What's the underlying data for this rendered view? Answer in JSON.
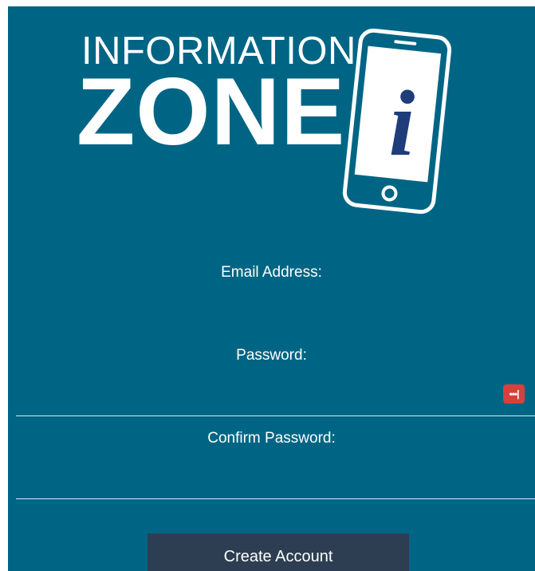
{
  "logo": {
    "line1": "INFORMATION",
    "line2": "ZONE",
    "badge_letter": "i"
  },
  "form": {
    "email_label": "Email Address:",
    "email_value": "",
    "password_label": "Password:",
    "password_value": "",
    "confirm_label": "Confirm Password:",
    "confirm_value": "",
    "password_manager_icon": "•••|",
    "submit_label": "Create Account"
  },
  "colors": {
    "panel_background": "#006584",
    "button_background": "#2d3e52",
    "password_manager_icon": "#d7403b",
    "logo_letter": "#1f3d7a"
  }
}
